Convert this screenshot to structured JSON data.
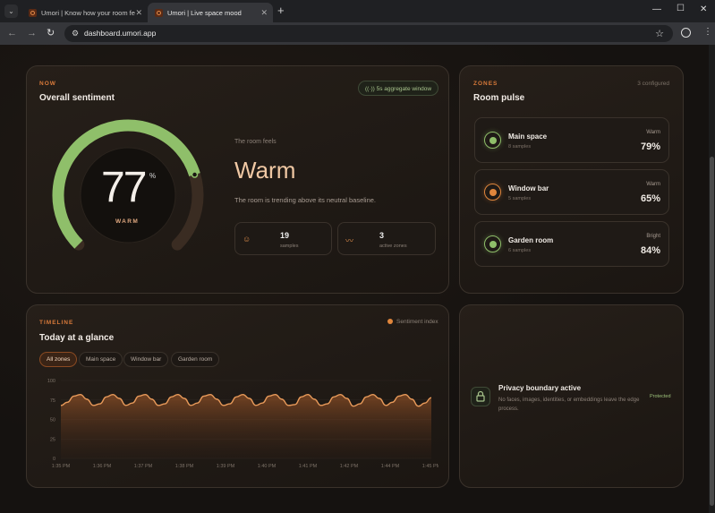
{
  "browser": {
    "tabs": [
      {
        "title": "Umori | Know how your room fe"
      },
      {
        "title": "Umori | Live space mood"
      }
    ],
    "url": "dashboard.umori.app",
    "icons": {
      "menu": "chevron-down-icon",
      "back": "back-arrow-icon",
      "forward": "forward-arrow-icon",
      "reload": "reload-icon",
      "tune": "site-settings-icon",
      "star": "bookmark-star-icon",
      "profile": "profile-icon",
      "more": "more-vert-icon"
    }
  },
  "now": {
    "kicker": "NOW",
    "title": "Overall sentiment",
    "window_pill": "5s aggregate window",
    "gauge": {
      "value": "77",
      "unit": "%",
      "label": "WARM",
      "fraction": 0.77
    },
    "feels_label": "The room feels",
    "mood": "Warm",
    "trend": "The room is trending above its neutral baseline.",
    "stats": [
      {
        "value": "19",
        "label": "samples",
        "icon": "people-icon"
      },
      {
        "value": "3",
        "label": "active zones",
        "icon": "activity-icon"
      }
    ]
  },
  "zones": {
    "kicker": "ZONES",
    "title": "Room pulse",
    "configured": "3 configured",
    "items": [
      {
        "name": "Main space",
        "samples": "8 samples",
        "mood": "Warm",
        "pct": "79%",
        "color": "#8fbf6a"
      },
      {
        "name": "Window bar",
        "samples": "5 samples",
        "mood": "Warm",
        "pct": "65%",
        "color": "#e0863c"
      },
      {
        "name": "Garden room",
        "samples": "6 samples",
        "mood": "Bright",
        "pct": "84%",
        "color": "#8fbf6a"
      }
    ]
  },
  "timeline": {
    "kicker": "TIMELINE",
    "title": "Today at a glance",
    "legend": "Sentiment index",
    "filters": [
      "All zones",
      "Main space",
      "Window bar",
      "Garden room"
    ],
    "active_filter": 0
  },
  "privacy": {
    "title": "Privacy boundary active",
    "text": "No faces, images, identities, or embeddings leave the edge process.",
    "badge": "Protected",
    "icon": "lock-icon"
  },
  "colors": {
    "accent": "#e0863c",
    "positive": "#8fbf6a",
    "text_muted": "#8c8178"
  },
  "chart_data": {
    "type": "area",
    "title": "",
    "xlabel": "",
    "ylabel": "",
    "ylim": [
      0,
      100
    ],
    "y_ticks": [
      0,
      25,
      50,
      75,
      100
    ],
    "x_ticks": [
      "1:35 PM",
      "1:36 PM",
      "1:37 PM",
      "1:38 PM",
      "1:39 PM",
      "1:40 PM",
      "1:41 PM",
      "1:42 PM",
      "1:44 PM",
      "1:45 PM"
    ],
    "series": [
      {
        "name": "Sentiment index",
        "values": [
          68,
          72,
          80,
          82,
          76,
          68,
          70,
          79,
          82,
          77,
          68,
          71,
          80,
          82,
          76,
          68,
          70,
          79,
          82,
          77,
          68,
          71,
          80,
          82,
          76,
          68,
          70,
          79,
          82,
          77,
          68,
          71,
          80,
          82,
          76,
          68,
          69,
          79,
          82,
          76,
          68,
          70,
          79,
          82,
          77,
          67,
          70,
          79,
          82,
          77,
          68,
          72,
          80,
          82,
          76,
          67,
          71,
          78
        ]
      }
    ]
  }
}
